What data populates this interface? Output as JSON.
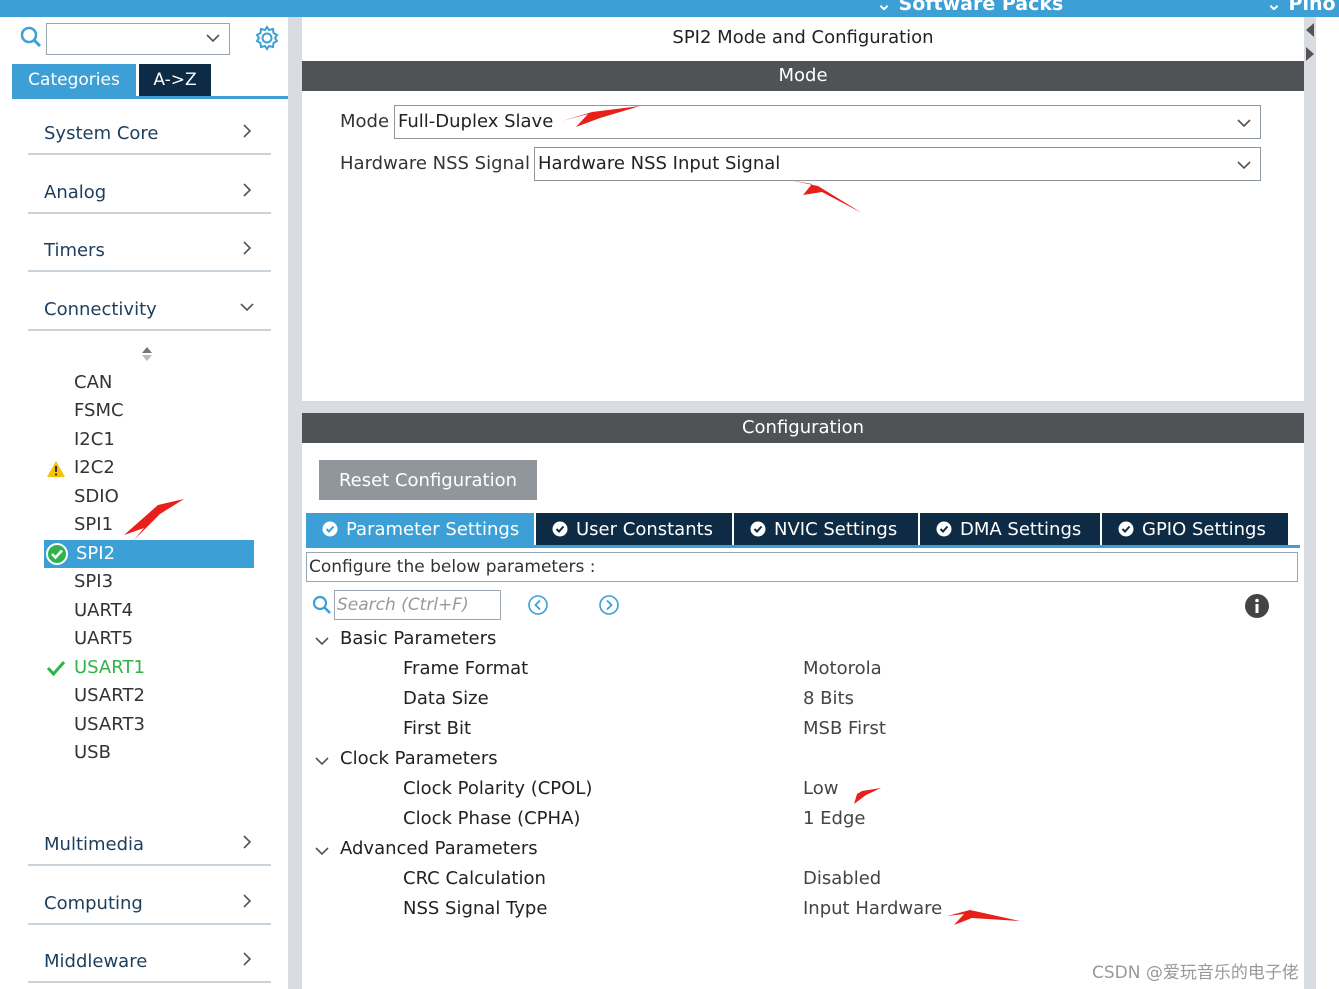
{
  "top_banner": {
    "left_text": "⌄ Software Packs",
    "right_text": "⌄ Pino"
  },
  "sidebar": {
    "search": {
      "placeholder": ""
    },
    "tabs": [
      {
        "label": "Categories",
        "active": true
      },
      {
        "label": "A->Z",
        "active": false
      }
    ],
    "categories": [
      {
        "label": "System Core",
        "expanded": false
      },
      {
        "label": "Analog",
        "expanded": false
      },
      {
        "label": "Timers",
        "expanded": false
      },
      {
        "label": "Connectivity",
        "expanded": true
      },
      {
        "label": "Multimedia",
        "expanded": false
      },
      {
        "label": "Computing",
        "expanded": false
      },
      {
        "label": "Middleware",
        "expanded": false
      }
    ],
    "peripherals": [
      {
        "label": "CAN",
        "status": "none"
      },
      {
        "label": "FSMC",
        "status": "none"
      },
      {
        "label": "I2C1",
        "status": "none"
      },
      {
        "label": "I2C2",
        "status": "warning"
      },
      {
        "label": "SDIO",
        "status": "none"
      },
      {
        "label": "SPI1",
        "status": "none"
      },
      {
        "label": "SPI2",
        "status": "selected-configured"
      },
      {
        "label": "SPI3",
        "status": "none"
      },
      {
        "label": "UART4",
        "status": "none"
      },
      {
        "label": "UART5",
        "status": "none"
      },
      {
        "label": "USART1",
        "status": "configured"
      },
      {
        "label": "USART2",
        "status": "none"
      },
      {
        "label": "USART3",
        "status": "none"
      },
      {
        "label": "USB",
        "status": "none"
      }
    ]
  },
  "main": {
    "title": "SPI2 Mode and Configuration",
    "mode_section": "Mode",
    "mode_label": "Mode",
    "mode_value": "Full-Duplex Slave",
    "nss_label": "Hardware NSS Signal",
    "nss_value": "Hardware NSS Input Signal",
    "config_section": "Configuration",
    "reset_button": "Reset Configuration",
    "tabs": [
      {
        "label": "Parameter Settings",
        "active": true
      },
      {
        "label": "User Constants",
        "active": false
      },
      {
        "label": "NVIC Settings",
        "active": false
      },
      {
        "label": "DMA Settings",
        "active": false
      },
      {
        "label": "GPIO Settings",
        "active": false
      }
    ],
    "description": "Configure the below parameters :",
    "param_search_placeholder": "Search (Ctrl+F)",
    "groups": [
      {
        "label": "Basic Parameters",
        "params": [
          {
            "name": "Frame Format",
            "value": "Motorola"
          },
          {
            "name": "Data Size",
            "value": "8 Bits"
          },
          {
            "name": "First Bit",
            "value": "MSB First"
          }
        ]
      },
      {
        "label": "Clock Parameters",
        "params": [
          {
            "name": "Clock Polarity (CPOL)",
            "value": "Low"
          },
          {
            "name": "Clock Phase (CPHA)",
            "value": "1 Edge"
          }
        ]
      },
      {
        "label": "Advanced Parameters",
        "params": [
          {
            "name": "CRC Calculation",
            "value": "Disabled"
          },
          {
            "name": "NSS Signal Type",
            "value": "Input Hardware"
          }
        ]
      }
    ]
  },
  "colors": {
    "accent": "#3c9fd6",
    "dark_navy": "#0d2b45",
    "section_bar": "#505355",
    "configured_green": "#2fb34a",
    "warning_yellow": "#f5c400",
    "annotation_red": "#e8201a"
  },
  "watermark": "CSDN @爱玩音乐的电子佬"
}
